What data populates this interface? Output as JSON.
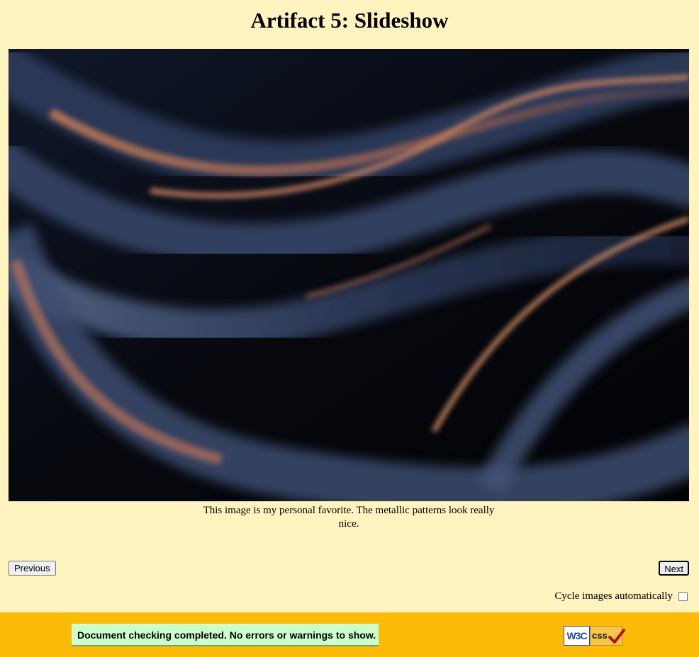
{
  "page": {
    "title": "Artifact 5: Slideshow"
  },
  "slide": {
    "image_alt": "abstract metallic swirl image",
    "caption": "This image is my personal favorite. The metallic patterns look really nice."
  },
  "controls": {
    "previous_label": "Previous",
    "next_label": "Next",
    "cycle_label": "Cycle images automatically",
    "cycle_checked": false
  },
  "footer": {
    "validator_message": "Document checking completed. No errors or warnings to show.",
    "badge": {
      "w3c_text": "W3C",
      "css_text": "css"
    }
  },
  "colors": {
    "page_bg": "#fff3c0",
    "footer_bg": "#fdba06",
    "validator_bg": "#ccffcc"
  }
}
